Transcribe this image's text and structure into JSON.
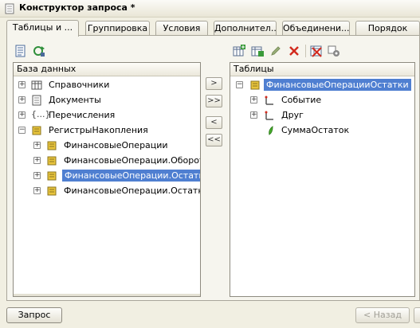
{
  "window": {
    "title": "Конструктор запроса *"
  },
  "tabs": [
    {
      "label": "Таблицы и ..."
    },
    {
      "label": "Группировка"
    },
    {
      "label": "Условия"
    },
    {
      "label": "Дополнител..."
    },
    {
      "label": "Объединени..."
    },
    {
      "label": "Порядок"
    }
  ],
  "left_pane": {
    "header": "База данных",
    "items": [
      {
        "label": "Справочники"
      },
      {
        "label": "Документы"
      },
      {
        "label": "Перечисления"
      },
      {
        "label": "РегистрыНакопления"
      },
      {
        "label": "ФинансовыеОперации"
      },
      {
        "label": "ФинансовыеОперации.Обороты"
      },
      {
        "label": "ФинансовыеОперации.Остатки"
      },
      {
        "label": "ФинансовыеОперации.ОстаткиИ"
      }
    ]
  },
  "right_pane": {
    "header": "Таблицы",
    "items": [
      {
        "label": "ФинансовыеОперацииОстатки"
      },
      {
        "label": "Событие"
      },
      {
        "label": "Друг"
      },
      {
        "label": "СуммаОстаток"
      }
    ]
  },
  "transfer_buttons": {
    "add_one": ">",
    "add_all": ">>",
    "remove_one": "<",
    "remove_all": "<<"
  },
  "footer": {
    "query_button": "Запрос",
    "back_button": "< Назад"
  },
  "colors": {
    "selection": "#4f7fd1",
    "icon_yellow": "#e8c43c",
    "delete_red": "#d22b1e"
  }
}
